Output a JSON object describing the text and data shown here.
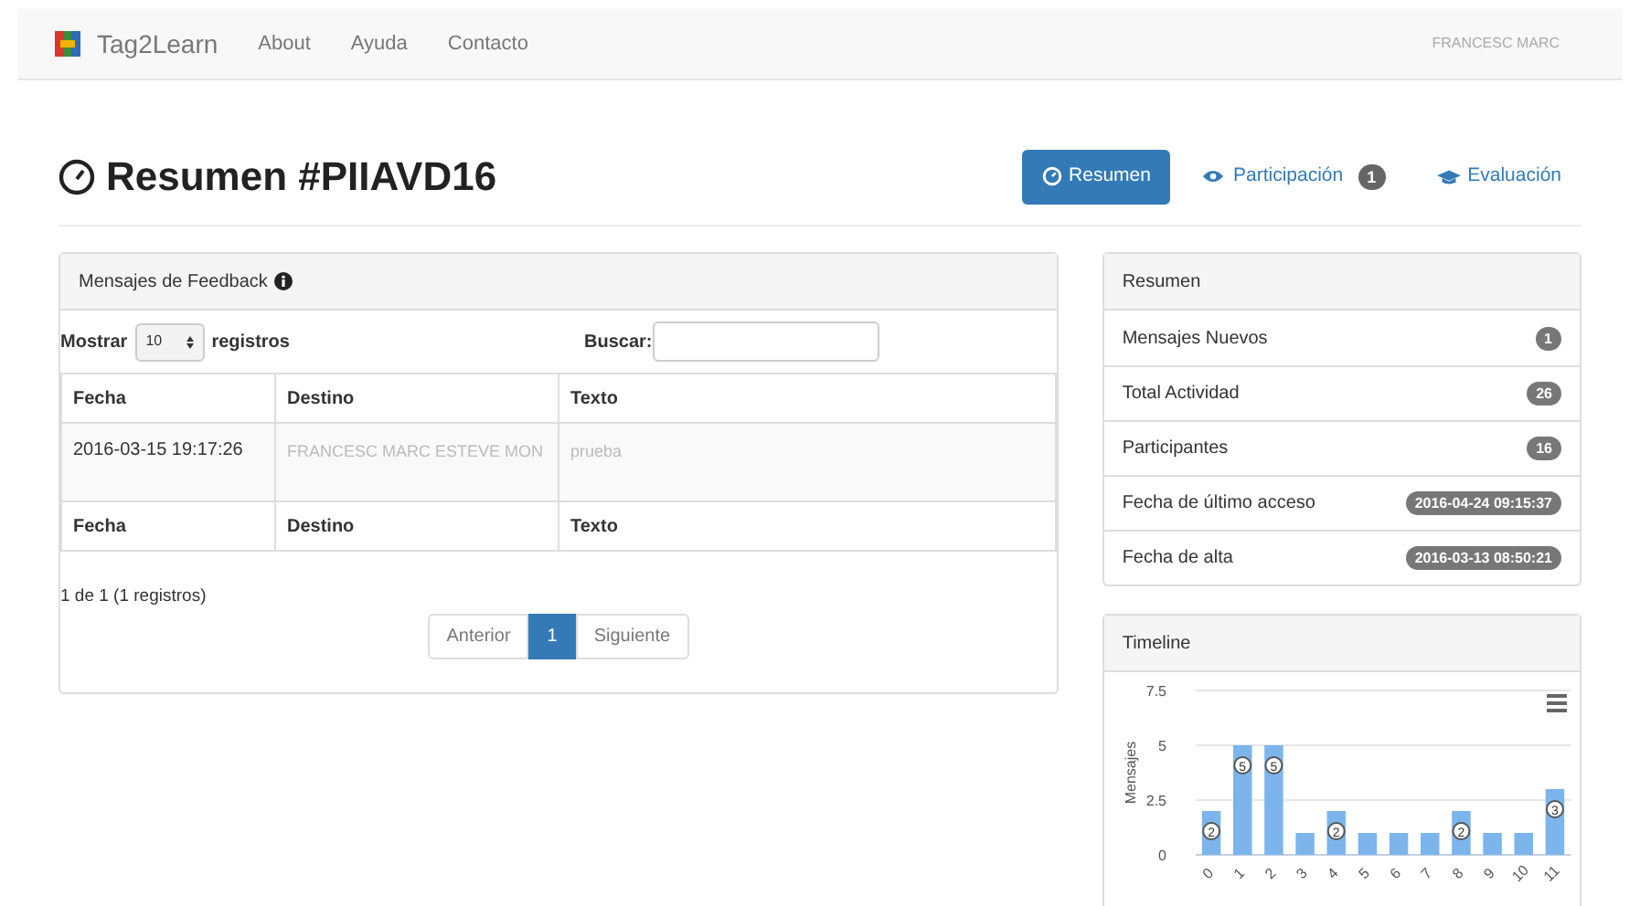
{
  "navbar": {
    "brand": "Tag2Learn",
    "links": [
      "About",
      "Ayuda",
      "Contacto"
    ],
    "user": "FRANCESC MARC"
  },
  "page": {
    "title": "Resumen #PIIAVD16"
  },
  "nav_pills": [
    {
      "label": "Resumen",
      "selected": true,
      "kind": "gauge"
    },
    {
      "label": "Participación",
      "selected": false,
      "kind": "eye",
      "badge": "1"
    },
    {
      "label": "Evaluación",
      "selected": false,
      "kind": "cap"
    }
  ],
  "feedback": {
    "title": "Mensajes de Feedback",
    "show_label": "Mostrar",
    "page_size": "10",
    "records_label": "registros",
    "search_label": "Buscar:",
    "columns": [
      "Fecha",
      "Destino",
      "Texto"
    ],
    "rows": [
      [
        "2016-03-15 19:17:26",
        "FRANCESC MARC ESTEVE MON",
        "prueba"
      ]
    ],
    "footer_columns": [
      "Fecha",
      "Destino",
      "Texto"
    ],
    "info": "1 de 1 (1 registros)",
    "pagination": [
      {
        "label": "Anterior",
        "selected": false
      },
      {
        "label": "1",
        "selected": true
      },
      {
        "label": "Siguiente",
        "selected": false
      }
    ]
  },
  "summary": {
    "title": "Resumen",
    "items": [
      {
        "label": "Mensajes Nuevos",
        "value": "1"
      },
      {
        "label": "Total Actividad",
        "value": "26"
      },
      {
        "label": "Participantes",
        "value": "16"
      },
      {
        "label": "Fecha de último acceso",
        "value": "2016-04-24 09:15:37"
      },
      {
        "label": "Fecha de alta",
        "value": "2016-03-13 08:50:21"
      }
    ]
  },
  "timeline": {
    "title": "Timeline",
    "chart_data": {
      "type": "bar",
      "ylabel": "Mensajes",
      "categories": [
        "0",
        "1",
        "2",
        "3",
        "4",
        "5",
        "6",
        "7",
        "8",
        "9",
        "10",
        "11"
      ],
      "series": [
        {
          "color": "#7cb5ec",
          "values": [
            2,
            5,
            5,
            1,
            2,
            1,
            1,
            1,
            2,
            1,
            1,
            3
          ]
        }
      ],
      "ylim": [
        0,
        7.5
      ],
      "yticks": [
        0,
        2.5,
        5,
        7.5
      ],
      "value_labels": [
        "2",
        "5",
        "5",
        null,
        "2",
        null,
        null,
        null,
        "2",
        null,
        null,
        "3"
      ]
    }
  }
}
